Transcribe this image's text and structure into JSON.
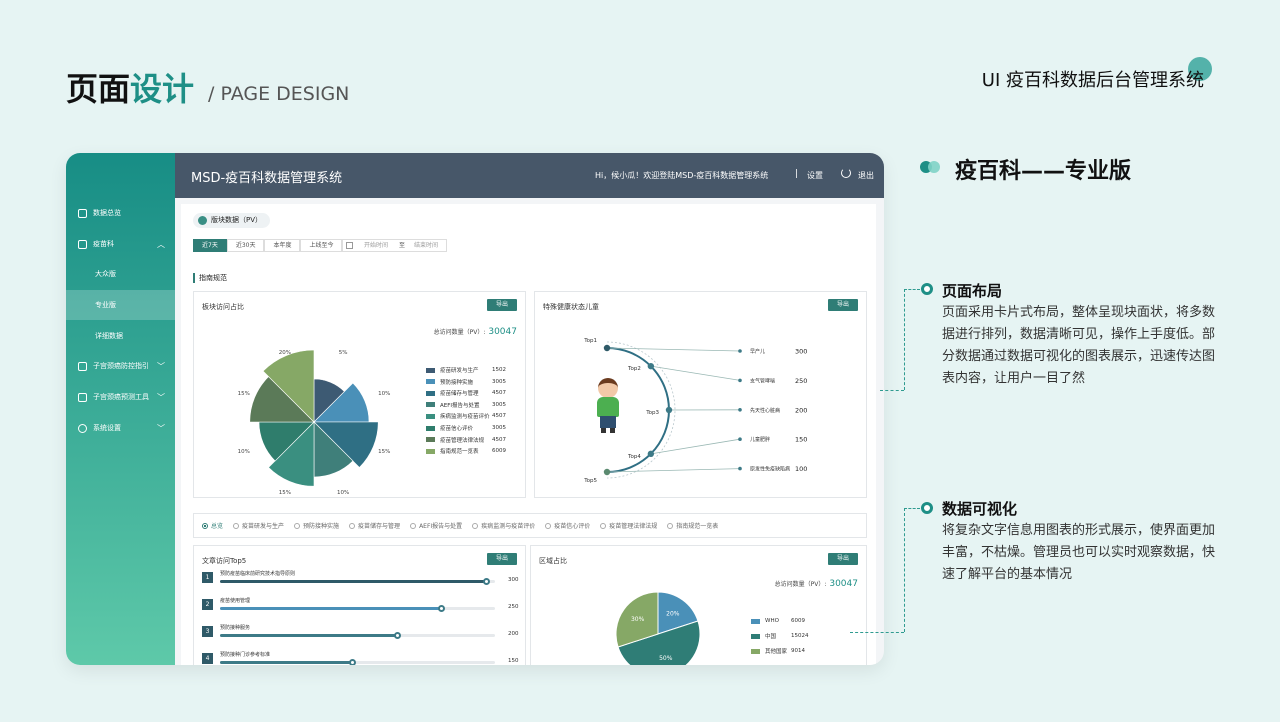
{
  "page": {
    "title_black": "页面",
    "title_green": "设计",
    "title_en": "/ PAGE DESIGN",
    "system_name": "UI  疫百科数据后台管理系统"
  },
  "sidebar": {
    "items": [
      {
        "label": "数据总览"
      },
      {
        "label": "疫苗科"
      },
      {
        "label": "大众版"
      },
      {
        "label": "专业版"
      },
      {
        "label": "详细数据"
      },
      {
        "label": "子宫颈癌防控指引"
      },
      {
        "label": "子宫颈癌预测工具"
      },
      {
        "label": "系统设置"
      }
    ]
  },
  "topbar": {
    "brand": "MSD-疫百科数据管理系统",
    "greeting": "Hi，候小瓜！欢迎登陆MSD-疫百科数据管理系统",
    "separator": "|",
    "settings": "设置",
    "logout": "退出"
  },
  "main": {
    "crumb": "版块数据（PV）",
    "tabs": [
      "近7天",
      "近30天",
      "本年度",
      "上线至今"
    ],
    "date_start": "开始时间",
    "date_mid": "至",
    "date_end": "结束时间",
    "section": "指南规范",
    "export": "导出"
  },
  "card1": {
    "title": "板块访问占比",
    "total_label": "总访问数量（PV）:",
    "total_value": "30047"
  },
  "card2": {
    "title": "特殊健康状态儿童"
  },
  "card3": {
    "title": "文章访问Top5"
  },
  "card4": {
    "title": "区域占比",
    "total_label": "总访问数量（PV）:",
    "total_value": "30047"
  },
  "filters": [
    "总览",
    "疫苗研发与生产",
    "预防接种实施",
    "疫苗储存与管理",
    "AEFI报告与处置",
    "疾病监测与疫苗评价",
    "疫苗信心评价",
    "疫苗管理法律法规",
    "指南规范一览表"
  ],
  "colors": {
    "teal_dark": "#2f7d76",
    "blue": "#4a90b8",
    "green_light": "#86a866",
    "slate": "#475769"
  },
  "chart_data": [
    {
      "type": "pie",
      "subtype": "rose",
      "title": "板块访问占比",
      "categories": [
        "疫苗研发与生产",
        "预防接种实施",
        "疫苗储存与管理",
        "AEFI报告与处置",
        "疾病监测与疫苗评价",
        "疫苗信心评价",
        "疫苗管理法律法规",
        "指南规范一览表"
      ],
      "values": [
        1502,
        3005,
        4507,
        3005,
        4507,
        3005,
        4507,
        6009
      ],
      "slice_labels": [
        "5%",
        "10%",
        "15%",
        "10%",
        "15%",
        "10%",
        "15%",
        "20%"
      ],
      "colors": [
        "#3d5a73",
        "#4a90b8",
        "#2f6f84",
        "#3f7f7a",
        "#3a8f80",
        "#2f7d6c",
        "#5b7a58",
        "#86a866"
      ],
      "legend": "right"
    },
    {
      "type": "table",
      "title": "特殊健康状态儿童",
      "ranks": [
        "Top1",
        "Top2",
        "Top3",
        "Top4",
        "Top5"
      ],
      "categories": [
        "早产儿",
        "支气管哮喘",
        "先天性心脏病",
        "儿童肥胖",
        "原发性免疫缺陷病"
      ],
      "values": [
        300,
        250,
        200,
        150,
        100
      ]
    },
    {
      "type": "bar",
      "title": "文章访问Top5",
      "categories": [
        "预防疫苗临床前研究技术指导原则",
        "疫苗使用管理",
        "预防接种服务",
        "预防接种门诊参考标准"
      ],
      "values": [
        300,
        250,
        200,
        150
      ],
      "ranks": [
        "1",
        "2",
        "3",
        "4"
      ]
    },
    {
      "type": "pie",
      "title": "区域占比",
      "categories": [
        "WHO",
        "中国",
        "其他国家"
      ],
      "values": [
        6009,
        15024,
        9014
      ],
      "slice_labels": [
        "20%",
        "50%",
        "30%"
      ],
      "colors": [
        "#4a90b8",
        "#2f7d76",
        "#86a866"
      ],
      "legend": "right"
    }
  ],
  "right": {
    "heading": "疫百科——专业版",
    "sec1_title": "页面布局",
    "sec1_body": "页面采用卡片式布局，整体呈现块面状，将多数据进行排列，数据清晰可见，操作上手度低。部分数据通过数据可视化的图表展示，迅速传达图表内容，让用户一目了然",
    "sec2_title": "数据可视化",
    "sec2_body": "将复杂文字信息用图表的形式展示，使界面更加丰富，不枯燥。管理员也可以实时观察数据，快速了解平台的基本情况"
  }
}
